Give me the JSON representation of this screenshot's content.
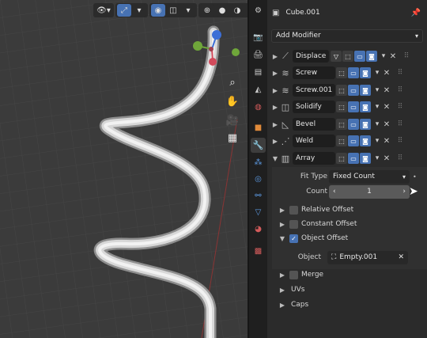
{
  "viewport": {
    "header_buttons": [
      "view-icon",
      "transform-icon",
      "snap-icon",
      "shading-icon",
      "overlay-icon"
    ],
    "nav_icons": [
      "zoom-icon",
      "hand-pan-icon",
      "camera-icon",
      "grid-icon"
    ]
  },
  "properties": {
    "object_name": "Cube.001",
    "add_modifier_label": "Add Modifier",
    "modifiers": [
      {
        "name": "Displace",
        "expanded": false
      },
      {
        "name": "Screw",
        "expanded": false
      },
      {
        "name": "Screw.001",
        "expanded": false
      },
      {
        "name": "Solidify",
        "expanded": false
      },
      {
        "name": "Bevel",
        "expanded": false
      },
      {
        "name": "Weld",
        "expanded": false
      },
      {
        "name": "Array",
        "expanded": true
      }
    ],
    "array": {
      "fit_type_label": "Fit Type",
      "fit_type_value": "Fixed Count",
      "count_label": "Count",
      "count_value": "1",
      "relative_offset_label": "Relative Offset",
      "constant_offset_label": "Constant Offset",
      "object_offset_label": "Object Offset",
      "object_label": "Object",
      "object_value": "Empty.001",
      "merge_label": "Merge",
      "uvs_label": "UVs",
      "caps_label": "Caps"
    }
  },
  "colors": {
    "accent": "#4772b3",
    "viewport_bg": "#3b3b3b",
    "panel_bg": "#2b2b2b"
  }
}
